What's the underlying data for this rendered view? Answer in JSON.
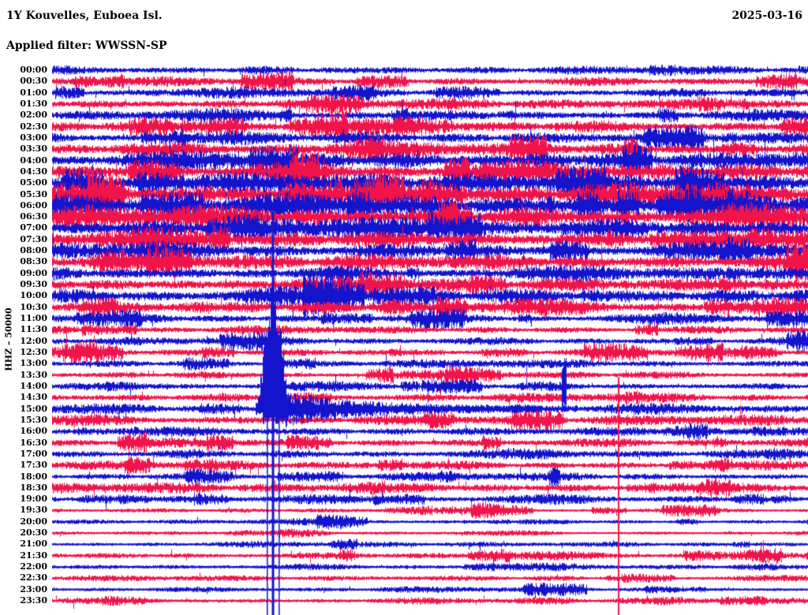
{
  "header": {
    "station_line": "1Y Kouvelles, Euboea Isl.",
    "date": "2025-03-16",
    "filter_line": "Applied filter: WWSSN-SP"
  },
  "y_axis": {
    "label": "HHZ – 50000"
  },
  "colors": {
    "trace_blue": "#1414cd",
    "trace_red": "#f0144b",
    "text": "#000000",
    "background": "#ffffff"
  },
  "chart_data": {
    "type": "line",
    "subtype": "helicorder-seismogram-24h",
    "station": "1Y Kouvelles, Euboea Isl.",
    "network": "1Y",
    "channel": "HHZ",
    "scale_label": "HHZ – 50000",
    "date": "2025-03-16",
    "applied_filter": "WWSSN-SP",
    "row_minutes": 30,
    "legend_position": "none",
    "grid": false,
    "rows": [
      {
        "time": "00:00",
        "color": "blue",
        "amp": 5
      },
      {
        "time": "00:30",
        "color": "red",
        "amp": 5.5
      },
      {
        "time": "01:00",
        "color": "blue",
        "amp": 6
      },
      {
        "time": "01:30",
        "color": "red",
        "amp": 7
      },
      {
        "time": "02:00",
        "color": "blue",
        "amp": 7
      },
      {
        "time": "02:30",
        "color": "red",
        "amp": 8
      },
      {
        "time": "03:00",
        "color": "blue",
        "amp": 7.5
      },
      {
        "time": "03:30",
        "color": "red",
        "amp": 9
      },
      {
        "time": "04:00",
        "color": "blue",
        "amp": 11
      },
      {
        "time": "04:30",
        "color": "red",
        "amp": 12
      },
      {
        "time": "05:00",
        "color": "blue",
        "amp": 13
      },
      {
        "time": "05:30",
        "color": "red",
        "amp": 13.5
      },
      {
        "time": "06:00",
        "color": "blue",
        "amp": 14
      },
      {
        "time": "06:30",
        "color": "red",
        "amp": 14
      },
      {
        "time": "07:00",
        "color": "blue",
        "amp": 13
      },
      {
        "time": "07:30",
        "color": "red",
        "amp": 12
      },
      {
        "time": "08:00",
        "color": "blue",
        "amp": 10.5
      },
      {
        "time": "08:30",
        "color": "red",
        "amp": 10
      },
      {
        "time": "09:00",
        "color": "blue",
        "amp": 9
      },
      {
        "time": "09:30",
        "color": "red",
        "amp": 9
      },
      {
        "time": "10:00",
        "color": "blue",
        "amp": 10
      },
      {
        "time": "10:30",
        "color": "red",
        "amp": 9
      },
      {
        "time": "11:00",
        "color": "blue",
        "amp": 6
      },
      {
        "time": "11:30",
        "color": "red",
        "amp": 5
      },
      {
        "time": "12:00",
        "color": "blue",
        "amp": 5
      },
      {
        "time": "12:30",
        "color": "red",
        "amp": 5
      },
      {
        "time": "13:00",
        "color": "blue",
        "amp": 5
      },
      {
        "time": "13:30",
        "color": "red",
        "amp": 5
      },
      {
        "time": "14:00",
        "color": "blue",
        "amp": 5
      },
      {
        "time": "14:30",
        "color": "red",
        "amp": 5.5
      },
      {
        "time": "15:00",
        "color": "blue",
        "amp": 6
      },
      {
        "time": "15:30",
        "color": "red",
        "amp": 6.5
      },
      {
        "time": "16:00",
        "color": "blue",
        "amp": 5.5
      },
      {
        "time": "16:30",
        "color": "red",
        "amp": 5.5
      },
      {
        "time": "17:00",
        "color": "blue",
        "amp": 5.5
      },
      {
        "time": "17:30",
        "color": "red",
        "amp": 5.5
      },
      {
        "time": "18:00",
        "color": "blue",
        "amp": 5
      },
      {
        "time": "18:30",
        "color": "red",
        "amp": 6.5
      },
      {
        "time": "19:00",
        "color": "blue",
        "amp": 5.5
      },
      {
        "time": "19:30",
        "color": "red",
        "amp": 3.5
      },
      {
        "time": "20:00",
        "color": "blue",
        "amp": 3.5
      },
      {
        "time": "20:30",
        "color": "red",
        "amp": 3
      },
      {
        "time": "21:00",
        "color": "blue",
        "amp": 3.5
      },
      {
        "time": "21:30",
        "color": "red",
        "amp": 4.5
      },
      {
        "time": "22:00",
        "color": "blue",
        "amp": 4
      },
      {
        "time": "22:30",
        "color": "red",
        "amp": 3.5
      },
      {
        "time": "23:00",
        "color": "blue",
        "amp": 3.5
      },
      {
        "time": "23:30",
        "color": "red",
        "amp": 4
      }
    ],
    "events": [
      {
        "row": "15:00",
        "x_fraction": 0.292,
        "kind": "large-clipped-burst",
        "color": "blue",
        "note": "major event; saturated burst paints vertical stripe across plot with decaying coda"
      },
      {
        "row": "14:30",
        "x_fraction": 0.749,
        "kind": "clipped-spike",
        "color": "red",
        "note": "clipped spike painting thin red vertical line to bottom of plot"
      },
      {
        "row": "14:00",
        "x_fraction": 0.676,
        "kind": "small-spike",
        "color": "blue",
        "note": "small local burst spanning ~2 rows"
      }
    ]
  }
}
